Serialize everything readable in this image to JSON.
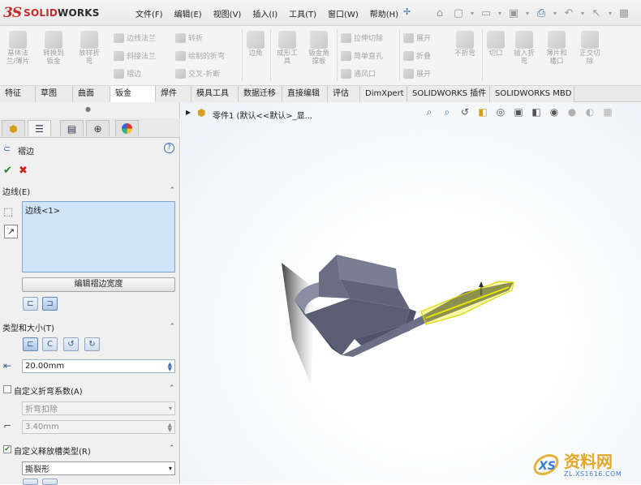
{
  "app": {
    "logo_ds": "3S",
    "logo_brand_red": "SOLID",
    "logo_brand_dark": "WORKS"
  },
  "menu": [
    "文件(F)",
    "编辑(E)",
    "视图(V)",
    "插入(I)",
    "工具(T)",
    "窗口(W)",
    "帮助(H)"
  ],
  "commands": {
    "left_col": [
      {
        "label": "基体法\n兰/薄片"
      },
      {
        "label": "转换到\n钣金"
      },
      {
        "label": "放样折\n弯"
      }
    ],
    "mid_small": [
      "边线法兰",
      "斜接法兰",
      "褶边",
      "转折",
      "绘制的折弯",
      "交叉-折断"
    ],
    "corner": "边角",
    "right_big": [
      {
        "label": "成形工\n具"
      },
      {
        "label": "钣金角\n撑板"
      }
    ],
    "cut_small": [
      "拉伸切除",
      "简单直孔",
      "通风口"
    ],
    "fold_small": [
      "展开",
      "折叠",
      "展开"
    ],
    "tail_big": [
      {
        "label": "不折弯"
      },
      {
        "label": "切口"
      },
      {
        "label": "插入折\n弯"
      },
      {
        "label": "薄片和\n槽口"
      },
      {
        "label": "正交切\n除"
      }
    ]
  },
  "tabs": [
    "特征",
    "草图",
    "曲面",
    "钣金",
    "焊件",
    "模具工具",
    "数据迁移",
    "直接编辑",
    "评估",
    "DimXpert",
    "SOLIDWORKS 插件",
    "SOLIDWORKS MBD"
  ],
  "active_tab": "钣金",
  "tree": {
    "part_label": "零件1 (默认<<默认>_显..."
  },
  "property_manager": {
    "title": "褶边",
    "help": "?",
    "ok": "✔",
    "cancel": "✖",
    "edges_group": "边线(E)",
    "edge_item": "边线<1>",
    "edit_width_button": "编辑褶边宽度",
    "type_size_group": "类型和大小(T)",
    "length_value": "20.00mm",
    "custom_bend_label": "自定义折弯系数(A)",
    "bend_deduction": "折弯扣除",
    "bend_value": "3.40mm",
    "relief_label": "自定义释放槽类型(R)",
    "relief_type": "撕裂形"
  },
  "watermark": {
    "title": "资料网",
    "url": "ZL.XS1616.COM"
  },
  "colors": {
    "accent_red": "#c42b2b",
    "selection": "#e6e600",
    "part": "#5d6177"
  }
}
